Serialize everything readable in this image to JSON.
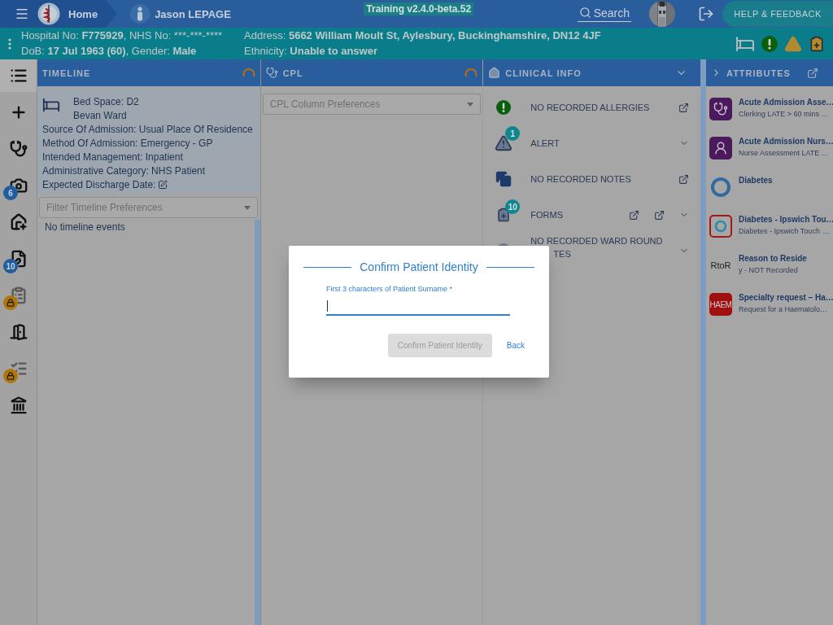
{
  "top_bar": {
    "home": "Home",
    "patient_name": "Jason LEPAGE",
    "version": "Training v2.4.0-beta.52",
    "search": "Search",
    "help": "HELP & FEEDBACK"
  },
  "banner": {
    "lines": [
      [
        {
          "text": "Hospital No: ",
          "bold": false
        },
        {
          "text": "F775929",
          "bold": true
        },
        {
          "text": ", NHS No: ***-***-****",
          "bold": false
        }
      ],
      [
        {
          "text": "DoB: ",
          "bold": false
        },
        {
          "text": "17 Jul 1963 (60)",
          "bold": true
        },
        {
          "text": ", Gender: ",
          "bold": false
        },
        {
          "text": "Male",
          "bold": true
        }
      ],
      [
        {
          "text": "Address: ",
          "bold": false
        },
        {
          "text": "5662 William Moult St, Aylesbury, Buckinghamshire, DN12 4JF",
          "bold": true
        }
      ],
      [
        {
          "text": "Ethnicity: ",
          "bold": false
        },
        {
          "text": "Unable to answer",
          "bold": true
        }
      ]
    ]
  },
  "rail": {
    "items": [
      {
        "selected": true
      },
      {
        "selected": false
      },
      {
        "selected": false
      },
      {
        "selected": false,
        "badge": "6"
      },
      {
        "selected": false
      },
      {
        "selected": false,
        "badge": "10"
      },
      {
        "selected": false,
        "locked": true
      },
      {
        "selected": false
      },
      {
        "selected": false,
        "locked": true
      },
      {
        "selected": false
      }
    ]
  },
  "timeline": {
    "title": "TIMELINE",
    "loading": true,
    "bed_space": "Bed Space: D2",
    "ward": "Bevan Ward",
    "details": [
      "Source Of Admission: Usual Place Of Residence",
      "Method Of Admission: Emergency - GP",
      "Intended Management: Inpatient",
      "Administrative Category: NHS Patient",
      "Expected Discharge Date:"
    ],
    "filter": {
      "placeholder": "Filter Timeline Preferences"
    },
    "empty": "No timeline events"
  },
  "cpl": {
    "title": "CPL",
    "loading": true,
    "select": {
      "placeholder": "CPL Column Preferences"
    }
  },
  "clinical_info": {
    "title": "CLINICAL INFO",
    "items": [
      {
        "kind": "allergies",
        "label": "NO RECORDED ALLERGIES",
        "actions": [
          {
            "kind": "link"
          }
        ]
      },
      {
        "kind": "alert",
        "label": "ALERT",
        "badge": "1",
        "actions": [
          {
            "kind": "chevron"
          }
        ]
      },
      {
        "kind": "notes",
        "label": "NO RECORDED NOTES",
        "actions": [
          {
            "kind": "link"
          }
        ]
      },
      {
        "kind": "forms",
        "label": "FORMS",
        "badge": "10",
        "actions": [
          {
            "kind": "link"
          },
          {
            "kind": "link"
          },
          {
            "kind": "chevron"
          }
        ]
      },
      {
        "kind": "ward_round",
        "label": "NO RECORDED WARD ROUND",
        "label_rest": "TES",
        "actions": [
          {
            "kind": "chevron"
          }
        ]
      }
    ]
  },
  "attributes": {
    "title": "ATTRIBUTES",
    "items": [
      {
        "kind": "doctor",
        "title": "Acute Admission Asse…",
        "subtitle": "Clerking LATE > 60 mins …"
      },
      {
        "kind": "nurse",
        "title": "Acute Admission Nurs…",
        "subtitle": "Nurse Assessment LATE …"
      },
      {
        "kind": "ring",
        "title": "Diabetes"
      },
      {
        "kind": "framed_ring",
        "title": "Diabetes - Ipswich Tou…",
        "subtitle": "Diabetes - Ipswich Touch …"
      },
      {
        "kind": "text",
        "icon_text": "RtoR",
        "title": "Reason to Reside",
        "subtitle": "y - NOT Recorded"
      },
      {
        "kind": "tile",
        "icon_text": "HAEM",
        "title": "Specialty request – Ha…",
        "subtitle": "Request for a Haematolo…"
      }
    ]
  },
  "dialog": {
    "title": "Confirm Patient Identity",
    "field_label": "First 3 characters of Patient Surname *",
    "focused": true,
    "buttons": [
      {
        "kind": "primary",
        "label": "Confirm Patient Identity",
        "disabled": true
      },
      {
        "kind": "text",
        "label": "Back",
        "disabled": false
      }
    ]
  }
}
